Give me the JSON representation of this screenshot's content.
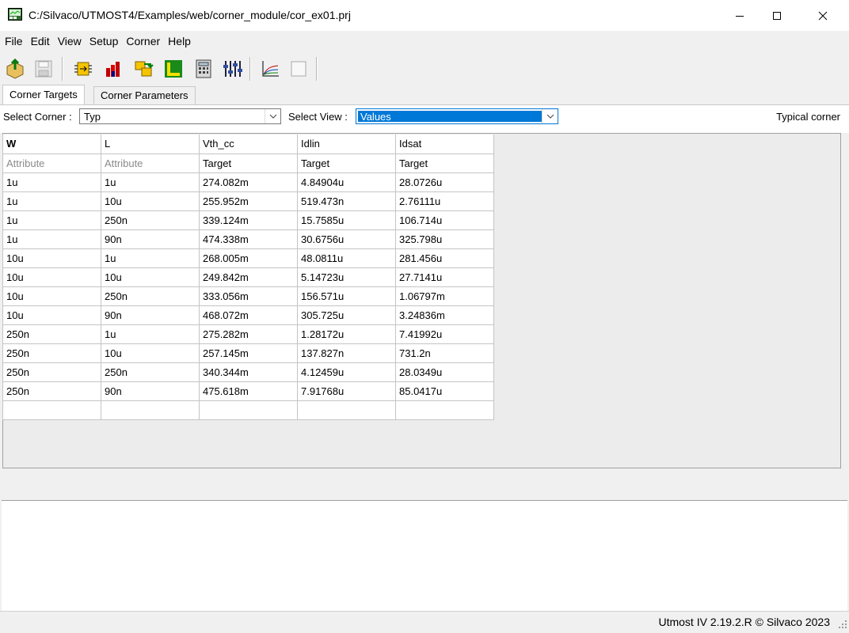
{
  "window": {
    "title": "C:/Silvaco/UTMOST4/Examples/web/corner_module/cor_ex01.prj"
  },
  "menu": [
    "File",
    "Edit",
    "View",
    "Setup",
    "Corner",
    "Help"
  ],
  "toolbar": {
    "icons": [
      "open-icon",
      "save-icon",
      "module-icon",
      "chart-icon",
      "transfer-icon",
      "layout-icon",
      "calculator-icon",
      "sliders-icon",
      "plot-icon",
      "blank-icon"
    ]
  },
  "tabs": [
    {
      "label": "Corner Targets",
      "active": true
    },
    {
      "label": "Corner Parameters",
      "active": false
    }
  ],
  "selectors": {
    "corner_label": "Select Corner :",
    "corner_value": "Typ",
    "view_label": "Select View :",
    "view_value": "Values",
    "status_right": "Typical corner"
  },
  "grid": {
    "headers": [
      "W",
      "L",
      "Vth_cc",
      "Idlin",
      "Idsat"
    ],
    "subheaders": [
      "Attribute",
      "Attribute",
      "Target",
      "Target",
      "Target"
    ],
    "rows": [
      [
        "1u",
        "1u",
        "274.082m",
        "4.84904u",
        "28.0726u"
      ],
      [
        "1u",
        "10u",
        "255.952m",
        "519.473n",
        "2.76111u"
      ],
      [
        "1u",
        "250n",
        "339.124m",
        "15.7585u",
        "106.714u"
      ],
      [
        "1u",
        "90n",
        "474.338m",
        "30.6756u",
        "325.798u"
      ],
      [
        "10u",
        "1u",
        "268.005m",
        "48.0811u",
        "281.456u"
      ],
      [
        "10u",
        "10u",
        "249.842m",
        "5.14723u",
        "27.7141u"
      ],
      [
        "10u",
        "250n",
        "333.056m",
        "156.571u",
        "1.06797m"
      ],
      [
        "10u",
        "90n",
        "468.072m",
        "305.725u",
        "3.24836m"
      ],
      [
        "250n",
        "1u",
        "275.282m",
        "1.28172u",
        "7.41992u"
      ],
      [
        "250n",
        "10u",
        "257.145m",
        "137.827n",
        "731.2n"
      ],
      [
        "250n",
        "250n",
        "340.344m",
        "4.12459u",
        "28.0349u"
      ],
      [
        "250n",
        "90n",
        "475.618m",
        "7.91768u",
        "85.0417u"
      ],
      [
        "",
        "",
        "",
        "",
        ""
      ]
    ]
  },
  "status": {
    "text": "Utmost IV 2.19.2.R © Silvaco 2023"
  },
  "colors": {
    "selection": "#0078d7",
    "window_bg": "#f0f0f0"
  }
}
